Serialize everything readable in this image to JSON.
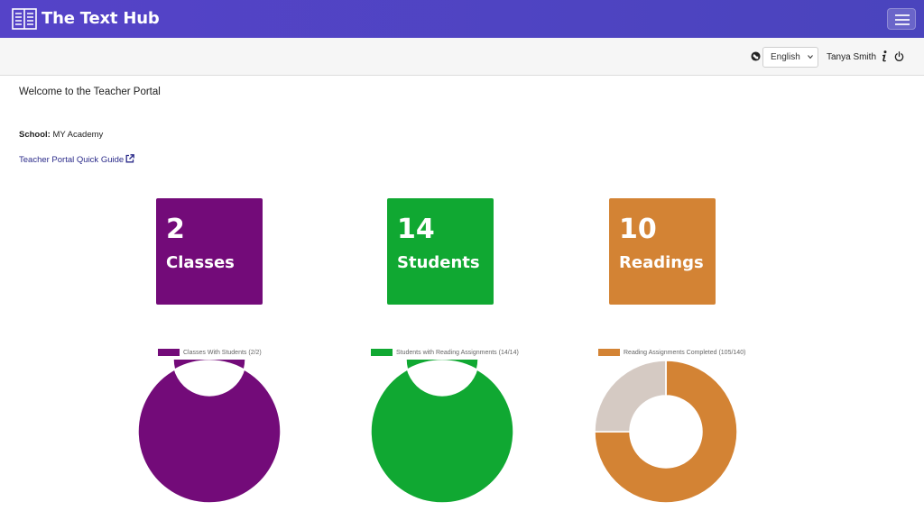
{
  "app": {
    "title": "The Text Hub"
  },
  "toolbar": {
    "language": "English",
    "user_name": "Tanya Smith"
  },
  "main": {
    "welcome": "Welcome to the Teacher Portal",
    "school_label": "School:",
    "school_name": "MY Academy",
    "guide_link": "Teacher Portal Quick Guide"
  },
  "stats": [
    {
      "value": "2",
      "label": "Classes",
      "color": "#730b79"
    },
    {
      "value": "14",
      "label": "Students",
      "color": "#10a832"
    },
    {
      "value": "10",
      "label": "Readings",
      "color": "#d38334"
    }
  ],
  "charts": [
    {
      "legend": "Classes With Students (2/2)",
      "color": "#730b79",
      "complete": 2,
      "total": 2
    },
    {
      "legend": "Students with Reading Assignments (14/14)",
      "color": "#10a832",
      "complete": 14,
      "total": 14
    },
    {
      "legend": "Reading Assignments Completed (105/140)",
      "color": "#d38334",
      "complete": 105,
      "total": 140
    }
  ],
  "colors": {
    "navbar": "#5543c8",
    "remainder": "#d5cac3"
  },
  "icons": {
    "logo": "book-icon",
    "language": "globe-icon",
    "info": "info-icon",
    "logout": "power-icon",
    "external": "external-link-icon",
    "menu": "hamburger-icon"
  }
}
